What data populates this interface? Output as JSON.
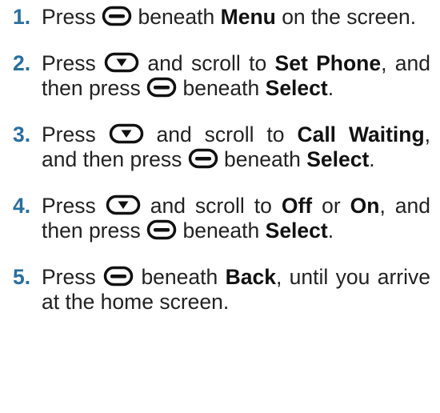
{
  "steps": [
    {
      "number": "1.",
      "parts": [
        {
          "t": "text",
          "v": "Press "
        },
        {
          "t": "icon",
          "v": "softkey-button-icon"
        },
        {
          "t": "text",
          "v": " beneath "
        },
        {
          "t": "bold",
          "v": "Menu"
        },
        {
          "t": "text",
          "v": " on the screen."
        }
      ]
    },
    {
      "number": "2.",
      "parts": [
        {
          "t": "text",
          "v": "Press "
        },
        {
          "t": "icon",
          "v": "down-arrow-button-icon"
        },
        {
          "t": "text",
          "v": " and scroll to "
        },
        {
          "t": "bold",
          "v": "Set Phone"
        },
        {
          "t": "text",
          "v": ", and then press "
        },
        {
          "t": "icon",
          "v": "softkey-button-icon"
        },
        {
          "t": "text",
          "v": " beneath "
        },
        {
          "t": "bold",
          "v": "Select"
        },
        {
          "t": "text",
          "v": "."
        }
      ]
    },
    {
      "number": "3.",
      "parts": [
        {
          "t": "text",
          "v": "Press "
        },
        {
          "t": "icon",
          "v": "down-arrow-button-icon"
        },
        {
          "t": "text",
          "v": " and scroll to "
        },
        {
          "t": "bold",
          "v": "Call Waiting"
        },
        {
          "t": "text",
          "v": ", and then press "
        },
        {
          "t": "icon",
          "v": "softkey-button-icon"
        },
        {
          "t": "text",
          "v": " beneath "
        },
        {
          "t": "bold",
          "v": "Select"
        },
        {
          "t": "text",
          "v": "."
        }
      ]
    },
    {
      "number": "4.",
      "parts": [
        {
          "t": "text",
          "v": "Press "
        },
        {
          "t": "icon",
          "v": "down-arrow-button-icon"
        },
        {
          "t": "text",
          "v": " and scroll to "
        },
        {
          "t": "bold",
          "v": "Off"
        },
        {
          "t": "text",
          "v": " or "
        },
        {
          "t": "bold",
          "v": "On"
        },
        {
          "t": "text",
          "v": ", and then press "
        },
        {
          "t": "icon",
          "v": "softkey-button-icon"
        },
        {
          "t": "text",
          "v": " beneath "
        },
        {
          "t": "bold",
          "v": "Select"
        },
        {
          "t": "text",
          "v": "."
        }
      ]
    },
    {
      "number": "5.",
      "parts": [
        {
          "t": "text",
          "v": "Press "
        },
        {
          "t": "icon",
          "v": "softkey-button-icon"
        },
        {
          "t": "text",
          "v": " beneath "
        },
        {
          "t": "bold",
          "v": "Back"
        },
        {
          "t": "text",
          "v": ", until you arrive at the home screen."
        }
      ]
    }
  ],
  "colors": {
    "step_number": "#2a6f9e",
    "text": "#222222"
  }
}
